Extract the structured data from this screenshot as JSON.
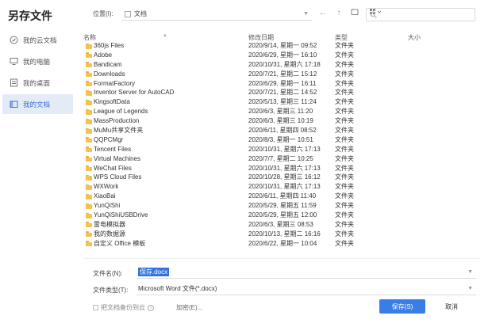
{
  "dialog": {
    "title": "另存文件"
  },
  "sidebar": {
    "items": [
      {
        "label": "我的云文档",
        "icon": "cloud-doc-icon",
        "active": false
      },
      {
        "label": "我的电脑",
        "icon": "monitor-icon",
        "active": false
      },
      {
        "label": "我的桌面",
        "icon": "desktop-icon",
        "active": false
      },
      {
        "label": "我的文档",
        "icon": "documents-icon",
        "active": true
      }
    ]
  },
  "toolbar": {
    "location_label": "位置(I):",
    "location_value": "文档"
  },
  "columns": {
    "name": "名称",
    "date": "修改日期",
    "type": "类型",
    "size": "大小"
  },
  "files": [
    {
      "name": "360js Files",
      "date": "2020/9/14, 星期一 09:52",
      "type": "文件夹"
    },
    {
      "name": "Adobe",
      "date": "2020/6/29, 星期一 16:10",
      "type": "文件夹"
    },
    {
      "name": "Bandicam",
      "date": "2020/10/31, 星期六 17:18",
      "type": "文件夹"
    },
    {
      "name": "Downloads",
      "date": "2020/7/21, 星期二 15:12",
      "type": "文件夹"
    },
    {
      "name": "FormatFactory",
      "date": "2020/6/29, 星期一 16:11",
      "type": "文件夹"
    },
    {
      "name": "Inventor Server for AutoCAD",
      "date": "2020/7/21, 星期二 14:52",
      "type": "文件夹"
    },
    {
      "name": "KingsoftData",
      "date": "2020/5/13, 星期三 11:24",
      "type": "文件夹"
    },
    {
      "name": "League of Legends",
      "date": "2020/6/3, 星期三 11:20",
      "type": "文件夹"
    },
    {
      "name": "MassProduction",
      "date": "2020/6/3, 星期三 10:19",
      "type": "文件夹"
    },
    {
      "name": "MuMu共享文件夹",
      "date": "2020/6/11, 星期四 08:52",
      "type": "文件夹"
    },
    {
      "name": "QQPCMgr",
      "date": "2020/8/3, 星期一 10:51",
      "type": "文件夹"
    },
    {
      "name": "Tencent Files",
      "date": "2020/10/31, 星期六 17:13",
      "type": "文件夹"
    },
    {
      "name": "Virtual Machines",
      "date": "2020/7/7, 星期二 10:25",
      "type": "文件夹"
    },
    {
      "name": "WeChat Files",
      "date": "2020/10/31, 星期六 17:13",
      "type": "文件夹"
    },
    {
      "name": "WPS Cloud Files",
      "date": "2020/10/28, 星期三 16:12",
      "type": "文件夹"
    },
    {
      "name": "WXWork",
      "date": "2020/10/31, 星期六 17:13",
      "type": "文件夹"
    },
    {
      "name": "XiaoBai",
      "date": "2020/6/11, 星期四 11:40",
      "type": "文件夹"
    },
    {
      "name": "YunQiShi",
      "date": "2020/5/29, 星期五 11:59",
      "type": "文件夹"
    },
    {
      "name": "YunQiShiUSBDrive",
      "date": "2020/5/29, 星期五 12:00",
      "type": "文件夹"
    },
    {
      "name": "雷电模拟器",
      "date": "2020/6/3, 星期三 08:53",
      "type": "文件夹"
    },
    {
      "name": "我的数据源",
      "date": "2020/10/13, 星期二 16:16",
      "type": "文件夹"
    },
    {
      "name": "自定义 Office 模板",
      "date": "2020/6/22, 星期一 10:04",
      "type": "文件夹"
    }
  ],
  "filename": {
    "label": "文件名(N):",
    "value": "保存.docx"
  },
  "filetype": {
    "label": "文件类型(T):",
    "value": "Microsoft Word 文件(*.docx)"
  },
  "backup": {
    "label": "把文档备份到云"
  },
  "encrypt": {
    "label": "加密(E)..."
  },
  "buttons": {
    "save": "保存(S)",
    "cancel": "取消"
  },
  "colors": {
    "accent": "#3b7de8",
    "folder": "#f5c34a",
    "sidebar_active_bg": "#e3ebf7"
  }
}
